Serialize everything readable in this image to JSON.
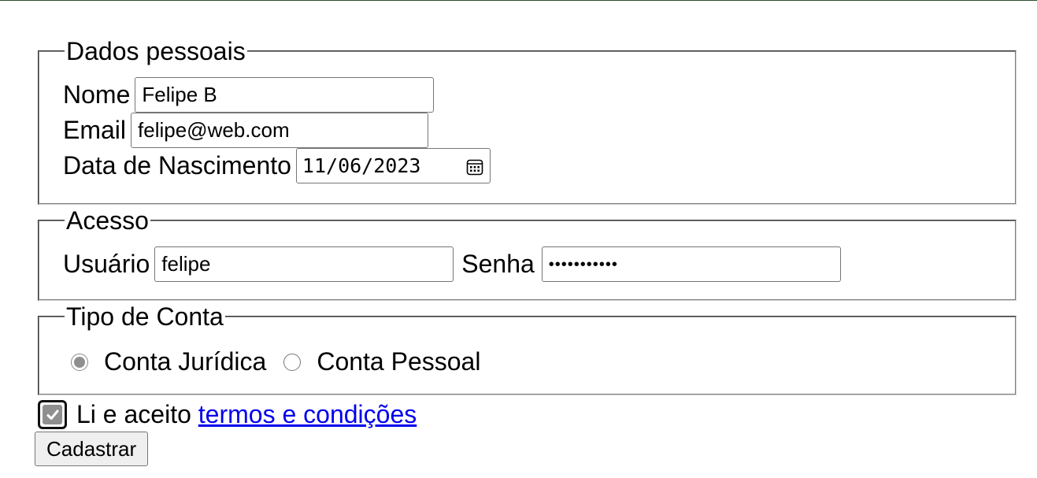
{
  "personal": {
    "legend": "Dados pessoais",
    "name_label": "Nome",
    "name_value": "Felipe B",
    "email_label": "Email",
    "email_value": "felipe@web.com",
    "birth_label": "Data de Nascimento",
    "birth_value": "11/06/2023"
  },
  "access": {
    "legend": "Acesso",
    "user_label": "Usuário",
    "user_value": "felipe",
    "password_label": "Senha",
    "password_mask": "•••••••••••"
  },
  "account_type": {
    "legend": "Tipo de Conta",
    "options": [
      {
        "label": "Conta Jurídica",
        "selected": true
      },
      {
        "label": "Conta Pessoal",
        "selected": false
      }
    ]
  },
  "terms": {
    "prefix": "Li e aceito",
    "link": "termos e condições",
    "checked": true
  },
  "submit_label": "Cadastrar",
  "icons": {
    "date": "calendar-icon",
    "checkbox": "checkmark-icon"
  }
}
